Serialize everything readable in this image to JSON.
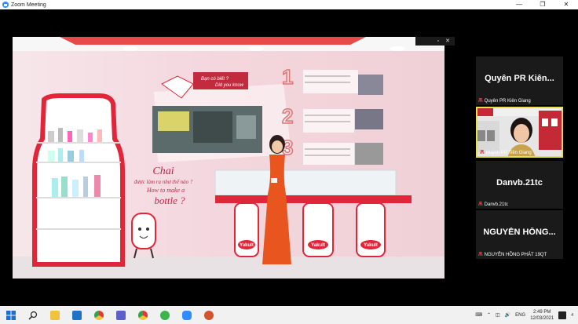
{
  "window": {
    "title": "Zoom Meeting",
    "minimize": "—",
    "restore": "❐",
    "close": "✕"
  },
  "video_controls": {
    "popout": "▫",
    "close": "✕"
  },
  "stage_text": {
    "chat": "Chai",
    "line1": "được làm ra như thế nào ?",
    "line2": "How to make a",
    "line3": "bottle ?",
    "bubble1": "Bạn có biết ?",
    "bubble2": "Did you know",
    "brand": "Yakult"
  },
  "participants": [
    {
      "big_name": "Quyên PR Kiên...",
      "label": "Quyên PR Kiên Giang",
      "muted": true,
      "has_video": false
    },
    {
      "big_name": "",
      "label": "Huỳnh PR Tiền Giang",
      "muted": true,
      "has_video": true
    },
    {
      "big_name": "Danvb.21tc",
      "label": "Danvb.21tc",
      "muted": true,
      "has_video": false
    },
    {
      "big_name": "NGUYỄN HỒNG...",
      "label": "NGUYỄN HỒNG PHÁT 19QT",
      "muted": true,
      "has_video": false
    }
  ],
  "taskbar": {
    "icons": [
      "windows-start-icon",
      "search-icon",
      "file-explorer-icon",
      "media-player-icon",
      "chrome-icon",
      "teams-icon",
      "chrome-profile-icon",
      "wechat-icon",
      "zoom-icon",
      "powerpoint-icon"
    ],
    "lang": "ENG",
    "time": "2:49 PM",
    "date": "12/03/2021",
    "notifications": "4"
  },
  "colors": {
    "accent_red": "#e2263a",
    "zoom_blue": "#2d8cff",
    "active_border": "#e8e04a"
  }
}
